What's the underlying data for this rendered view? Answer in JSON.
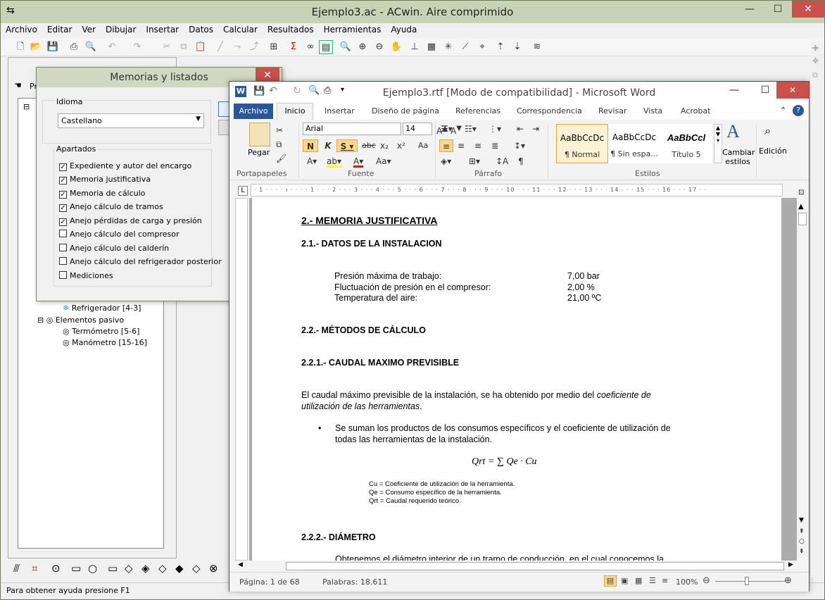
{
  "acwin": {
    "title": "Ejemplo3.ac - ACwin. Aire comprimido",
    "menu": [
      "Archivo",
      "Editar",
      "Ver",
      "Dibujar",
      "Insertar",
      "Datos",
      "Calcular",
      "Resultados",
      "Herramientas",
      "Ayuda"
    ],
    "status": "Para obtener ayuda presione F1",
    "panel_tab": "Pr",
    "tree": {
      "item_refrigerador": "Refrigerador [4-3]",
      "item_elementos": "Elementos pasivo",
      "item_termometro": "Termómetro [5-6]",
      "item_manometro": "Manómetro [15-16]"
    }
  },
  "dialog": {
    "title": "Memorias y listados",
    "idioma_label": "Idioma",
    "idioma_value": "Castellano",
    "apartados_label": "Apartados",
    "items": [
      {
        "label": "Expediente y autor del encargo",
        "checked": true
      },
      {
        "label": "Memoria justificativa",
        "checked": true
      },
      {
        "label": "Memoria de cálculo",
        "checked": true
      },
      {
        "label": "Anejo cálculo de tramos",
        "checked": true
      },
      {
        "label": "Anejo pérdidas de carga y presión",
        "checked": true
      },
      {
        "label": "Anejo cálculo del compresor",
        "checked": false
      },
      {
        "label": "Anejo cálculo del calderín",
        "checked": false
      },
      {
        "label": "Anejo cálculo del refrigerador posterior",
        "checked": false
      },
      {
        "label": "Mediciones",
        "checked": false
      }
    ]
  },
  "word": {
    "title": "Ejemplo3.rtf [Modo de compatibilidad]  -  Microsoft Word",
    "tabs": [
      "Archivo",
      "Inicio",
      "Insertar",
      "Diseño de página",
      "Referencias",
      "Correspondencia",
      "Revisar",
      "Vista",
      "Acrobat"
    ],
    "font_name": "Arial",
    "font_size": "14",
    "paste_label": "Pegar",
    "groups": [
      "Portapapeles",
      "Fuente",
      "Párrafo",
      "Estilos"
    ],
    "styles": [
      {
        "sample": "AaBbCcDc",
        "name": "¶ Normal"
      },
      {
        "sample": "AaBbCcDc",
        "name": "¶ Sin espa..."
      },
      {
        "sample": "AaBbCcl",
        "name": "Título 5"
      }
    ],
    "cambiar_estilos": "Cambiar estilos",
    "edicion": "Edición",
    "status_page": "Página: 1 de 68",
    "status_words": "Palabras: 18.611",
    "zoom": "100%",
    "doc": {
      "h1": "2.- MEMORIA JUSTIFICATIVA",
      "h21": "2.1.- DATOS  DE LA INSTALACION",
      "rows": [
        {
          "label": "Presión máxima de trabajo:",
          "value": "7,00 bar"
        },
        {
          "label": "Fluctuación de presión en el compresor:",
          "value": "2,00 %"
        },
        {
          "label": "Temperatura  del aire:",
          "value": "21,00 ºC"
        }
      ],
      "h22": "2.2.- MÉTODOS  DE CÁLCULO",
      "h221": "2.2.1.- CAUDAL  MAXIMO PREVISIBLE",
      "p1a": "El  caudal  máximo  previsible  de  la  instalación,  se  ha  obtenido  por  medio  del",
      "p1b_italic": "coeficiente  de",
      "p1c_italic": "utilización de las herramientas",
      "p1d": ".",
      "bullet1": "Se suman los productos de los consumos específicos y el coeficiente de utilización de",
      "bullet2": "todas las herramientas  de la instalación.",
      "formula": "Qrt = ∑ Qe · Cu",
      "legend": [
        "Cu = Coeficiente de utilización de la herramienta.",
        "Qe = Consumo específico de la herramienta.",
        "Qrt = Caudal requerido teórico."
      ],
      "h222": "2.2.2.- DIÁMETRO",
      "p2": "Obtenemos  el  diámetro  interior  de  un  tramo  de  conducción,  en  el cual  conocemos  la"
    }
  }
}
